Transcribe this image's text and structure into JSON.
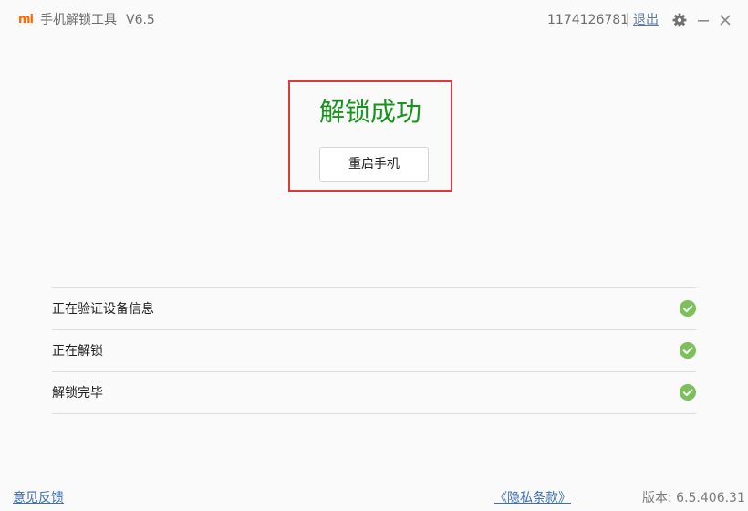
{
  "window": {
    "logo_text": "mi",
    "title": "手机解锁工具",
    "version": "V6.5",
    "account_id": "1174126781",
    "logout_label": "退出"
  },
  "result": {
    "title": "解锁成功",
    "restart_label": "重启手机"
  },
  "steps": [
    {
      "label": "正在验证设备信息",
      "status": "done"
    },
    {
      "label": "正在解锁",
      "status": "done"
    },
    {
      "label": "解锁完毕",
      "status": "done"
    }
  ],
  "footer": {
    "feedback_label": "意见反馈",
    "privacy_label": "《隐私条款》",
    "version_label": "版本: 6.5.406.31"
  },
  "colors": {
    "brand": "#ff6700",
    "success": "#16941c",
    "check": "#7cc05a",
    "highlight": "#e0383b",
    "link": "#3d6fb6"
  },
  "icons": [
    "mi-logo-icon",
    "gear-icon",
    "minimize-icon",
    "close-icon",
    "check-circle-icon"
  ]
}
